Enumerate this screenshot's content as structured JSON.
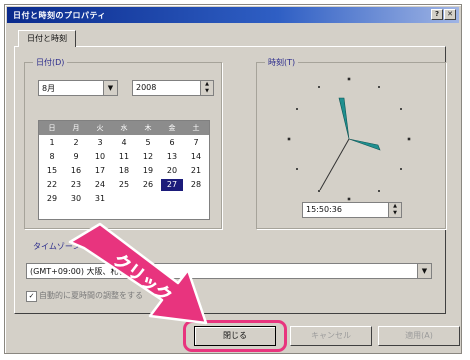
{
  "window": {
    "title": "日付と時刻のプロパティ",
    "close_button": "✕",
    "help_button": "?"
  },
  "tabs": [
    {
      "label": "日付と時刻"
    }
  ],
  "date_group": {
    "label": "日付(D)",
    "month": "8月",
    "year": "2008",
    "weekdays": [
      "日",
      "月",
      "火",
      "水",
      "木",
      "金",
      "土"
    ],
    "days": [
      [
        "",
        "",
        "",
        "",
        "",
        "",
        ""
      ],
      [
        "1",
        "2",
        "3",
        "4",
        "5",
        "6",
        "7"
      ],
      [
        "8",
        "9",
        "10",
        "11",
        "12",
        "13",
        "14"
      ],
      [
        "15",
        "16",
        "17",
        "18",
        "19",
        "20",
        "21"
      ],
      [
        "22",
        "23",
        "24",
        "25",
        "26",
        "27",
        "28"
      ],
      [
        "29",
        "30",
        "31",
        "",
        "",
        "",
        ""
      ]
    ],
    "selected_day": "27"
  },
  "time_group": {
    "label": "時刻(T)",
    "time": "15:50:36"
  },
  "timezone_group": {
    "label": "タイムゾーン",
    "value": "(GMT+09:00) 大阪、札幌、東京"
  },
  "dst": {
    "checked": true,
    "label": "自動的に夏時間の調整をする"
  },
  "buttons": {
    "ok": "閉じる",
    "cancel": "キャンセル",
    "apply": "適用(A)"
  },
  "annotation": {
    "text": "クリック",
    "color": "#e8347e"
  },
  "colors": {
    "title_bar": "#0a2a8c",
    "dialog_bg": "#d4d0c8",
    "selected_day": "#1b1b7a",
    "clock_hands": "#1f8f8f"
  }
}
